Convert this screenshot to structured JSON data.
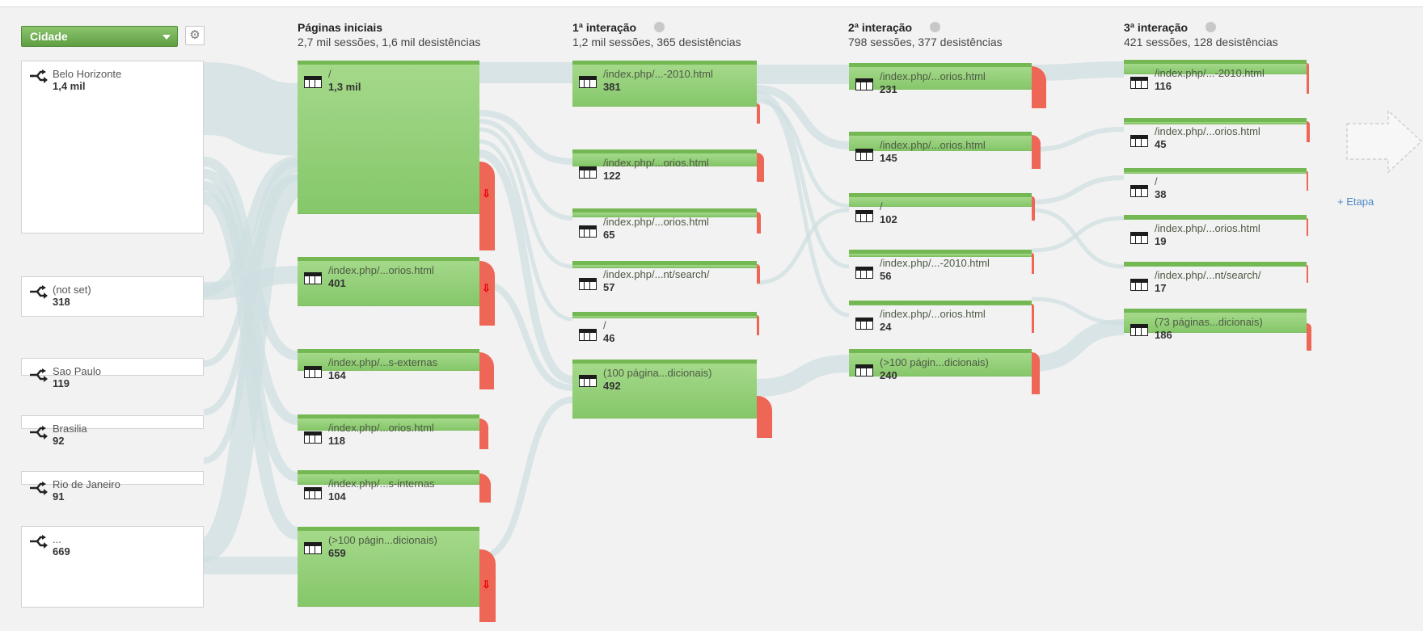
{
  "selector": {
    "dimension": "Cidade",
    "caret_icon": "chevron-down-icon",
    "settings_icon": "gear-icon"
  },
  "columns": [
    {
      "title": "Páginas iniciais",
      "subtitle": "2,7 mil sessões, 1,6 mil desistências"
    },
    {
      "title": "1ª interação",
      "subtitle": "1,2 mil sessões, 365 desistências"
    },
    {
      "title": "2ª interação",
      "subtitle": "798 sessões, 377 desistências"
    },
    {
      "title": "3ª interação",
      "subtitle": "421 sessões, 128 desistências"
    }
  ],
  "sources": [
    {
      "label": "Belo Horizonte",
      "count": "1,4 mil"
    },
    {
      "label": "(not set)",
      "count": "318"
    },
    {
      "label": "Sao Paulo",
      "count": "119"
    },
    {
      "label": "Brasilia",
      "count": "92"
    },
    {
      "label": "Rio de Janeiro",
      "count": "91"
    },
    {
      "label": "...",
      "count": "669"
    }
  ],
  "starting_pages": [
    {
      "label": "/",
      "count": "1,3 mil"
    },
    {
      "label": "/index.php/...orios.html",
      "count": "401"
    },
    {
      "label": "/index.php/...s-externas",
      "count": "164"
    },
    {
      "label": "/index.php/...orios.html",
      "count": "118"
    },
    {
      "label": "/index.php/...s-internas",
      "count": "104"
    },
    {
      "label": "(>100 págin...dicionais)",
      "count": "659"
    }
  ],
  "interaction_1": [
    {
      "label": "/index.php/...-2010.html",
      "count": "381"
    },
    {
      "label": "/index.php/...orios.html",
      "count": "122"
    },
    {
      "label": "/index.php/...orios.html",
      "count": "65"
    },
    {
      "label": "/index.php/...nt/search/",
      "count": "57"
    },
    {
      "label": "/",
      "count": "46"
    },
    {
      "label": "(100 página...dicionais)",
      "count": "492"
    }
  ],
  "interaction_2": [
    {
      "label": "/index.php/...orios.html",
      "count": "231"
    },
    {
      "label": "/index.php/...orios.html",
      "count": "145"
    },
    {
      "label": "/",
      "count": "102"
    },
    {
      "label": "/index.php/...-2010.html",
      "count": "56"
    },
    {
      "label": "/index.php/...orios.html",
      "count": "24"
    },
    {
      "label": "(>100 págin...dicionais)",
      "count": "240"
    }
  ],
  "interaction_3": [
    {
      "label": "/index.php/...-2010.html",
      "count": "116"
    },
    {
      "label": "/index.php/...orios.html",
      "count": "45"
    },
    {
      "label": "/",
      "count": "38"
    },
    {
      "label": "/index.php/...orios.html",
      "count": "19"
    },
    {
      "label": "/index.php/...nt/search/",
      "count": "17"
    },
    {
      "label": "(73 páginas...dicionais)",
      "count": "186"
    }
  ],
  "add_step": "+ Etapa",
  "drop_arrow_glyph": "⇩",
  "colors": {
    "node_fill": "#8fcf73",
    "node_top": "#74b854",
    "dropoff": "#ee6655",
    "flow": "#cfdfe0",
    "link": "#4d88c8"
  },
  "icons": {
    "source": "split-arrows-icon",
    "page": "page-table-icon",
    "remove_step": "close-circle-icon",
    "next_step": "next-step-arrow-icon"
  }
}
